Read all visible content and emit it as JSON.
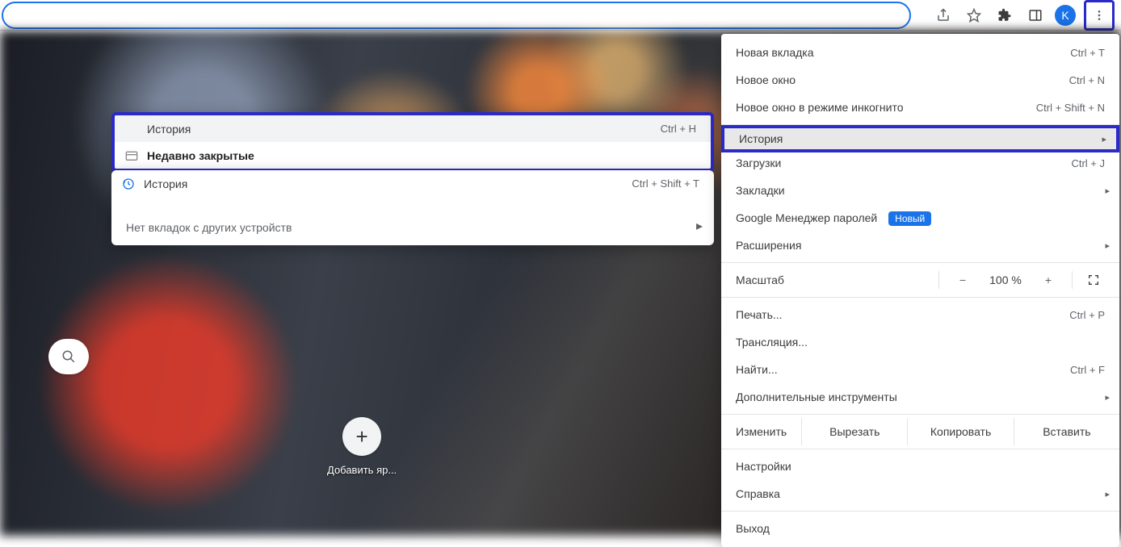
{
  "toolbar": {
    "avatar_letter": "K"
  },
  "newtab": {
    "add_shortcut_label": "Добавить яр..."
  },
  "history_submenu": {
    "row1_label": "История",
    "row1_shortcut": "Ctrl + H",
    "row2_label": "Недавно закрытые",
    "row3_label": "История",
    "row3_shortcut": "Ctrl + Shift + T",
    "footer": "Нет вкладок с других устройств"
  },
  "main_menu": {
    "new_tab": "Новая вкладка",
    "new_tab_sc": "Ctrl + T",
    "new_window": "Новое окно",
    "new_window_sc": "Ctrl + N",
    "incognito": "Новое окно в режиме инкогнито",
    "incognito_sc": "Ctrl + Shift + N",
    "history": "История",
    "downloads": "Загрузки",
    "downloads_sc": "Ctrl + J",
    "bookmarks": "Закладки",
    "passwords": "Google Менеджер паролей",
    "passwords_badge": "Новый",
    "extensions": "Расширения",
    "zoom_label": "Масштаб",
    "zoom_value": "100 %",
    "print": "Печать...",
    "print_sc": "Ctrl + P",
    "cast": "Трансляция...",
    "find": "Найти...",
    "find_sc": "Ctrl + F",
    "more_tools": "Дополнительные инструменты",
    "edit_label": "Изменить",
    "cut": "Вырезать",
    "copy": "Копировать",
    "paste": "Вставить",
    "settings": "Настройки",
    "help": "Справка",
    "exit": "Выход"
  }
}
